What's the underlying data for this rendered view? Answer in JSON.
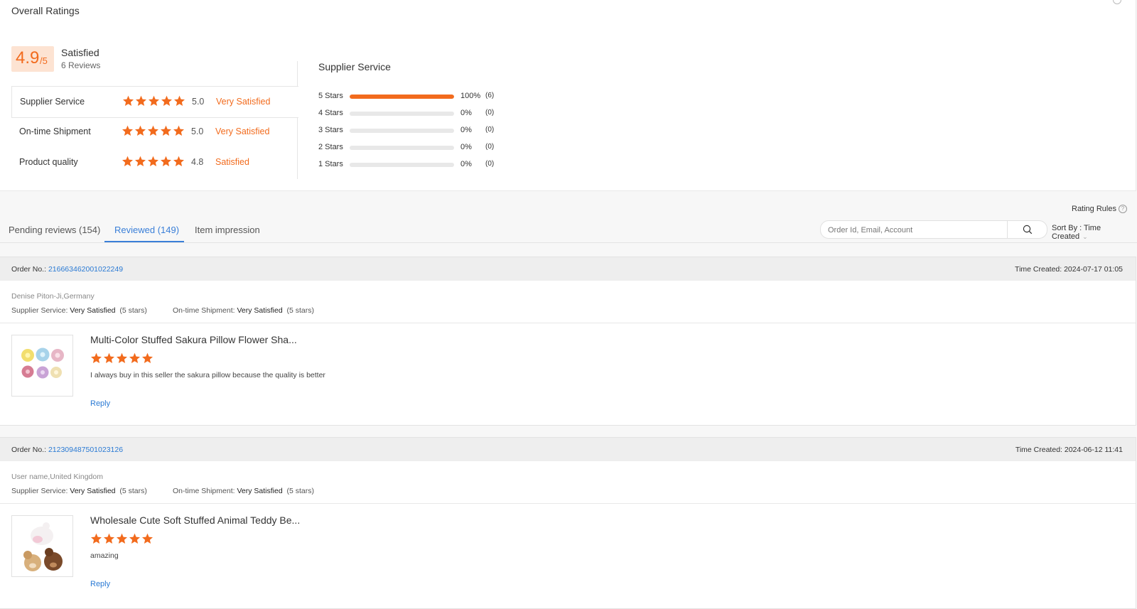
{
  "overall": {
    "title": "Overall Ratings",
    "score": "4.9",
    "score_denominator": "/5",
    "score_label": "Satisfied",
    "reviews_count": "6 Reviews",
    "categories": [
      {
        "label": "Supplier Service",
        "score": "5.0",
        "desc": "Very Satisfied",
        "stars": 5
      },
      {
        "label": "On-time Shipment",
        "score": "5.0",
        "desc": "Very Satisfied",
        "stars": 5
      },
      {
        "label": "Product quality",
        "score": "4.8",
        "desc": "Satisfied",
        "stars": 5
      }
    ]
  },
  "distribution": {
    "title": "Supplier Service",
    "rows": [
      {
        "label": "5  Stars",
        "pct": "100%",
        "count": "(6)",
        "fraction": 1.0
      },
      {
        "label": "4  Stars",
        "pct": "0%",
        "count": "(0)",
        "fraction": 0
      },
      {
        "label": "3  Stars",
        "pct": "0%",
        "count": "(0)",
        "fraction": 0
      },
      {
        "label": "2  Stars",
        "pct": "0%",
        "count": "(0)",
        "fraction": 0
      },
      {
        "label": "1  Stars",
        "pct": "0%",
        "count": "(0)",
        "fraction": 0
      }
    ]
  },
  "toolbar": {
    "rating_rules": "Rating Rules",
    "tabs": [
      {
        "label": "Pending reviews (154)"
      },
      {
        "label": "Reviewed (149)"
      },
      {
        "label": "Item impression"
      }
    ],
    "active_tab": 1,
    "search_placeholder": "Order Id, Email, Account",
    "sort_by": "Sort By : Time Created"
  },
  "reviews": [
    {
      "order_label": "Order No.: ",
      "order_no": "216663462001022249",
      "time": "Time Created: 2024-07-17 01:05",
      "buyer": "Denise Piton-Ji,Germany",
      "svc_label": "Supplier Service: ",
      "svc_value": "Very Satisfied",
      "svc_stars": "(5 stars)",
      "ship_label": "On-time Shipment: ",
      "ship_value": "Very Satisfied",
      "ship_stars": "(5 stars)",
      "product_title": "Multi-Color Stuffed Sakura Pillow Flower Sha...",
      "rating": 5,
      "comment": "I always buy in this seller the sakura pillow because the quality is better",
      "reply": "Reply"
    },
    {
      "order_label": "Order No.: ",
      "order_no": "212309487501023126",
      "time": "Time Created: 2024-06-12 11:41",
      "buyer": "User name,United Kingdom",
      "svc_label": "Supplier Service: ",
      "svc_value": "Very Satisfied",
      "svc_stars": "(5 stars)",
      "ship_label": "On-time Shipment: ",
      "ship_value": "Very Satisfied",
      "ship_stars": "(5 stars)",
      "product_title": "Wholesale Cute Soft Stuffed Animal Teddy Be...",
      "rating": 5,
      "comment": "amazing",
      "reply": "Reply"
    }
  ],
  "colors": {
    "accent": "#f26b1d",
    "link": "#2a7ad4",
    "tab_active": "#3a7fd8"
  }
}
